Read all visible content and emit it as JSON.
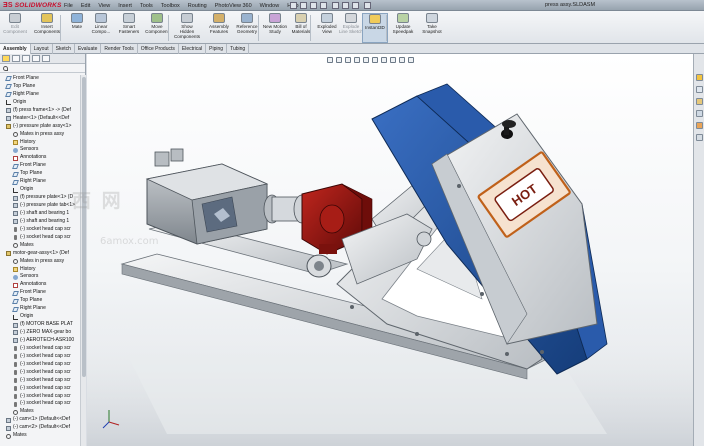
{
  "app": {
    "brand": "SOLIDWORKS",
    "document_title": "press assy.SLDASM"
  },
  "menubar": [
    "File",
    "Edit",
    "View",
    "Insert",
    "Tools",
    "Toolbox",
    "Routing",
    "PhotoView 360",
    "Window",
    "Help"
  ],
  "ribbon": {
    "buttons": [
      {
        "label": "Edit Component",
        "dim": true
      },
      {
        "label": "Insert Components",
        "dim": false
      },
      {
        "label": "Mate",
        "dim": false
      },
      {
        "label": "Linear Compo...",
        "dim": false
      },
      {
        "label": "Smart Fasteners",
        "dim": false
      },
      {
        "label": "Move Component",
        "dim": false
      },
      {
        "label": "Show Hidden Components",
        "dim": false
      },
      {
        "label": "Assembly Features",
        "dim": false
      },
      {
        "label": "Reference Geometry",
        "dim": false
      },
      {
        "label": "New Motion Study",
        "dim": false
      },
      {
        "label": "Bill of Materials",
        "dim": false
      },
      {
        "label": "Exploded View",
        "dim": false
      },
      {
        "label": "Explode Line Sketch",
        "dim": true
      },
      {
        "label": "Instant3D",
        "dim": false,
        "active": true
      },
      {
        "label": "Update Speedpak",
        "dim": false
      },
      {
        "label": "Take Snapshot",
        "dim": false
      }
    ]
  },
  "tabs": [
    "Assembly",
    "Layout",
    "Sketch",
    "Evaluate",
    "Render Tools",
    "Office Products",
    "Electrical",
    "Piping",
    "Tubing"
  ],
  "active_tab": "Assembly",
  "tree": [
    {
      "label": "Front Plane",
      "indent": 1,
      "icon": "plane"
    },
    {
      "label": "Top Plane",
      "indent": 1,
      "icon": "plane"
    },
    {
      "label": "Right Plane",
      "indent": 1,
      "icon": "plane"
    },
    {
      "label": "Origin",
      "indent": 1,
      "icon": "origin"
    },
    {
      "label": "(f) press frame<1> -> (Def",
      "indent": 1,
      "icon": "part"
    },
    {
      "label": "Heater<1> (Default<<Def",
      "indent": 1,
      "icon": "part"
    },
    {
      "label": "(-) pressure plate assy<1>",
      "indent": 1,
      "icon": "asm"
    },
    {
      "label": "Mates in press assy",
      "indent": 2,
      "icon": "mate"
    },
    {
      "label": "History",
      "indent": 2,
      "icon": "folder"
    },
    {
      "label": "Sensors",
      "indent": 2,
      "icon": "sensor"
    },
    {
      "label": "Annotations",
      "indent": 2,
      "icon": "anno"
    },
    {
      "label": "Front Plane",
      "indent": 2,
      "icon": "plane"
    },
    {
      "label": "Top Plane",
      "indent": 2,
      "icon": "plane"
    },
    {
      "label": "Right Plane",
      "indent": 2,
      "icon": "plane"
    },
    {
      "label": "Origin",
      "indent": 2,
      "icon": "origin"
    },
    {
      "label": "(f) pressure plate<1> (D",
      "indent": 2,
      "icon": "part"
    },
    {
      "label": "(-) pressure plate tab<1>",
      "indent": 2,
      "icon": "part"
    },
    {
      "label": "(-) shaft and bearing 1",
      "indent": 2,
      "icon": "part"
    },
    {
      "label": "(-) shaft and bearing 1",
      "indent": 2,
      "icon": "part"
    },
    {
      "label": "(-) socket head cap scr",
      "indent": 2,
      "icon": "screw"
    },
    {
      "label": "(-) socket head cap scr",
      "indent": 2,
      "icon": "screw"
    },
    {
      "label": "Mates",
      "indent": 2,
      "icon": "mate"
    },
    {
      "label": "motor-gear-assy<1> (Def",
      "indent": 1,
      "icon": "asm"
    },
    {
      "label": "Mates in press assy",
      "indent": 2,
      "icon": "mate"
    },
    {
      "label": "History",
      "indent": 2,
      "icon": "folder"
    },
    {
      "label": "Sensors",
      "indent": 2,
      "icon": "sensor"
    },
    {
      "label": "Annotations",
      "indent": 2,
      "icon": "anno"
    },
    {
      "label": "Front Plane",
      "indent": 2,
      "icon": "plane"
    },
    {
      "label": "Top Plane",
      "indent": 2,
      "icon": "plane"
    },
    {
      "label": "Right Plane",
      "indent": 2,
      "icon": "plane"
    },
    {
      "label": "Origin",
      "indent": 2,
      "icon": "origin"
    },
    {
      "label": "(f) MOTOR BASE PLAT",
      "indent": 2,
      "icon": "part"
    },
    {
      "label": "(-) ZERO MAX-gear bo",
      "indent": 2,
      "icon": "part"
    },
    {
      "label": "(-) AEROTECH-ASR100",
      "indent": 2,
      "icon": "part"
    },
    {
      "label": "(-) socket head cap scr",
      "indent": 2,
      "icon": "screw"
    },
    {
      "label": "(-) socket head cap scr",
      "indent": 2,
      "icon": "screw"
    },
    {
      "label": "(-) socket head cap scr",
      "indent": 2,
      "icon": "screw"
    },
    {
      "label": "(-) socket head cap scr",
      "indent": 2,
      "icon": "screw"
    },
    {
      "label": "(-) socket head cap scr",
      "indent": 2,
      "icon": "screw"
    },
    {
      "label": "(-) socket head cap scr",
      "indent": 2,
      "icon": "screw"
    },
    {
      "label": "(-) socket head cap scr",
      "indent": 2,
      "icon": "screw"
    },
    {
      "label": "(-) socket head cap scr",
      "indent": 2,
      "icon": "screw"
    },
    {
      "label": "Mates",
      "indent": 2,
      "icon": "mate"
    },
    {
      "label": "(-) cam<1> (Default<<Def",
      "indent": 1,
      "icon": "part"
    },
    {
      "label": "(-) cam<2> (Default<<Def",
      "indent": 1,
      "icon": "part"
    },
    {
      "label": "Mates",
      "indent": 1,
      "icon": "mate"
    }
  ],
  "model": {
    "hot_label": "HOT"
  },
  "watermark": {
    "text": "西 网",
    "sub": "6amox.com"
  },
  "colors": {
    "frame": "#e6e8ea",
    "blue_plate": "#1d4f9c",
    "gearbox_red": "#8e1410",
    "hot_orange": "#e07a2a"
  }
}
